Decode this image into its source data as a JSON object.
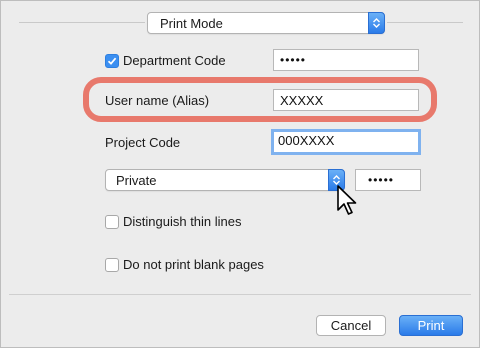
{
  "print_mode": {
    "label": "Print Mode"
  },
  "department_code": {
    "label": "Department Code",
    "checked": true,
    "value": "•••••"
  },
  "user_name": {
    "label": "User name (Alias)",
    "value": "XXXXX"
  },
  "project_code": {
    "label": "Project Code",
    "value": "000XXXX"
  },
  "job_type": {
    "selected": "Private",
    "pin_value": "•••••"
  },
  "options": {
    "thin_lines": {
      "label": "Distinguish thin lines",
      "checked": false
    },
    "blank_pages": {
      "label": "Do not print blank pages",
      "checked": false
    }
  },
  "buttons": {
    "cancel": "Cancel",
    "print": "Print"
  },
  "colors": {
    "accent": "#2a7be9",
    "highlight": "#e8796c",
    "panel": "#ececec"
  }
}
